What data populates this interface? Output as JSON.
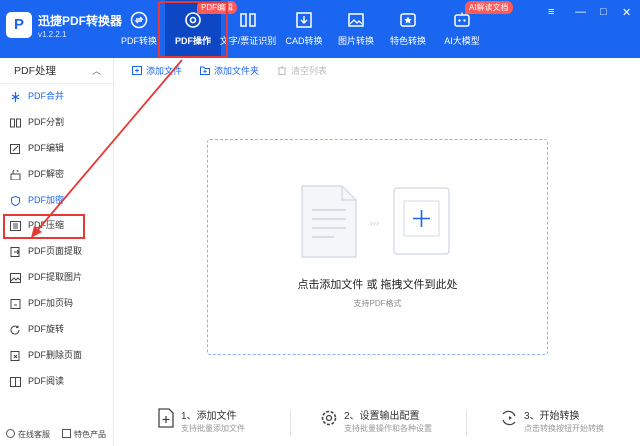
{
  "app": {
    "name": "迅捷PDF转换器",
    "version": "v1.2.2.1",
    "logo_glyph": "P"
  },
  "nav": {
    "tabs": [
      {
        "label": "PDF转换",
        "icon": "pdf-convert-icon"
      },
      {
        "label": "PDF操作",
        "icon": "gear-icon",
        "active": true
      },
      {
        "label": "文字/票证识别",
        "icon": "scan-icon"
      },
      {
        "label": "CAD转换",
        "icon": "cad-icon"
      },
      {
        "label": "图片转换",
        "icon": "image-icon"
      },
      {
        "label": "特色转换",
        "icon": "star-icon"
      },
      {
        "label": "AI大模型",
        "icon": "ai-icon"
      }
    ],
    "badge_pdf_edit": "PDF编辑",
    "badge_ai_doc": "AI解读文档"
  },
  "window_controls": {
    "menu": "≡",
    "minimize": "—",
    "maximize": "□",
    "close": "✕"
  },
  "sidebar": {
    "header": "PDF处理",
    "items": [
      {
        "label": "PDF合并",
        "icon": "merge-icon"
      },
      {
        "label": "PDF分割",
        "icon": "split-icon"
      },
      {
        "label": "PDF编辑",
        "icon": "edit-icon"
      },
      {
        "label": "PDF解密",
        "icon": "unlock-icon"
      },
      {
        "label": "PDF加密",
        "icon": "lock-icon"
      },
      {
        "label": "PDF压缩",
        "icon": "compress-icon"
      },
      {
        "label": "PDF页面提取",
        "icon": "page-extract-icon"
      },
      {
        "label": "PDF提取图片",
        "icon": "image-extract-icon"
      },
      {
        "label": "PDF加页码",
        "icon": "page-number-icon"
      },
      {
        "label": "PDF旋转",
        "icon": "rotate-icon"
      },
      {
        "label": "PDF删除页面",
        "icon": "delete-page-icon"
      },
      {
        "label": "PDF阅读",
        "icon": "read-icon"
      }
    ],
    "bottom": {
      "customer_service": "在线客服",
      "featured_products": "特色产品"
    }
  },
  "toolbar": {
    "add_file": "添加文件",
    "add_folder": "添加文件夹",
    "clear_list": "清空列表"
  },
  "dropzone": {
    "main_text": "点击添加文件 或 拖拽文件到此处",
    "sub_text": "支持PDF格式"
  },
  "steps": [
    {
      "title": "1、添加文件",
      "desc": "支持批量添加文件"
    },
    {
      "title": "2、设置输出配置",
      "desc": "支持批量操作和各种设置"
    },
    {
      "title": "3、开始转换",
      "desc": "点击转换按钮开始转换"
    }
  ],
  "colors": {
    "brand": "#1a66f0",
    "active_tab": "#0d47c4",
    "annotation_red": "#e53935"
  }
}
